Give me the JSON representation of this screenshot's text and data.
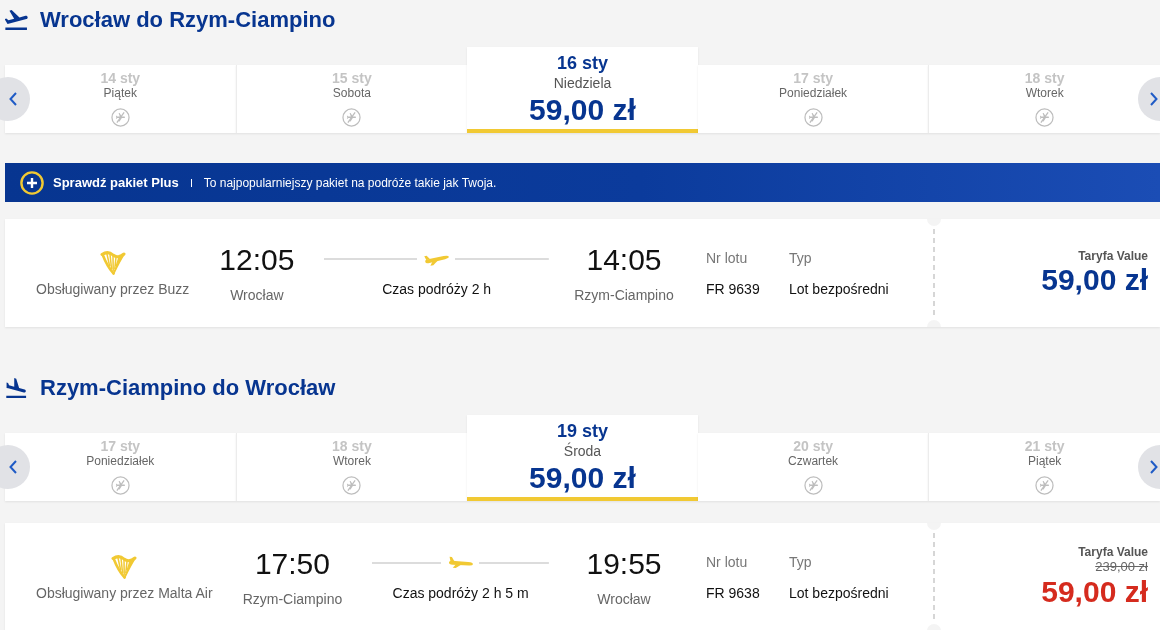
{
  "journeys": [
    {
      "kind": "outbound",
      "title": "Wrocław do Rzym-Ciampino",
      "dates": [
        {
          "date": "14 sty",
          "day": "Piątek",
          "available": false,
          "selected": false
        },
        {
          "date": "15 sty",
          "day": "Sobota",
          "available": false,
          "selected": false
        },
        {
          "date": "16 sty",
          "day": "Niedziela",
          "price": "59,00 zł",
          "available": true,
          "selected": true
        },
        {
          "date": "17 sty",
          "day": "Poniedziałek",
          "available": false,
          "selected": false
        },
        {
          "date": "18 sty",
          "day": "Wtorek",
          "available": false,
          "selected": false
        }
      ],
      "promo": {
        "title": "Sprawdź pakiet Plus",
        "text": "To najpopularniejszy pakiet na podróże takie jak Twoja."
      },
      "flight": {
        "operator": "Obsługiwany przez Buzz",
        "departure_time": "12:05",
        "departure_airport": "Wrocław",
        "duration": "Czas podróży 2 h",
        "arrival_time": "14:05",
        "arrival_airport": "Rzym-Ciampino",
        "flight_number_label": "Nr lotu",
        "flight_number": "FR 9639",
        "type_label": "Typ",
        "type": "Lot bezpośredni",
        "fare": "Taryfa Value",
        "price": "59,00 zł",
        "discounted": false
      }
    },
    {
      "kind": "return",
      "title": "Rzym-Ciampino do Wrocław",
      "dates": [
        {
          "date": "17 sty",
          "day": "Poniedziałek",
          "available": false,
          "selected": false
        },
        {
          "date": "18 sty",
          "day": "Wtorek",
          "available": false,
          "selected": false
        },
        {
          "date": "19 sty",
          "day": "Środa",
          "price": "59,00 zł",
          "available": true,
          "selected": true
        },
        {
          "date": "20 sty",
          "day": "Czwartek",
          "available": false,
          "selected": false
        },
        {
          "date": "21 sty",
          "day": "Piątek",
          "available": false,
          "selected": false
        }
      ],
      "flight": {
        "operator": "Obsługiwany przez Malta Air",
        "departure_time": "17:50",
        "departure_airport": "Rzym-Ciampino",
        "duration": "Czas podróży 2 h 5 m",
        "arrival_time": "19:55",
        "arrival_airport": "Wrocław",
        "flight_number_label": "Nr lotu",
        "flight_number": "FR 9638",
        "type_label": "Typ",
        "type": "Lot bezpośredni",
        "fare": "Taryfa Value",
        "old_price": "239,00 zł",
        "price": "59,00 zł",
        "discounted": true
      }
    }
  ]
}
